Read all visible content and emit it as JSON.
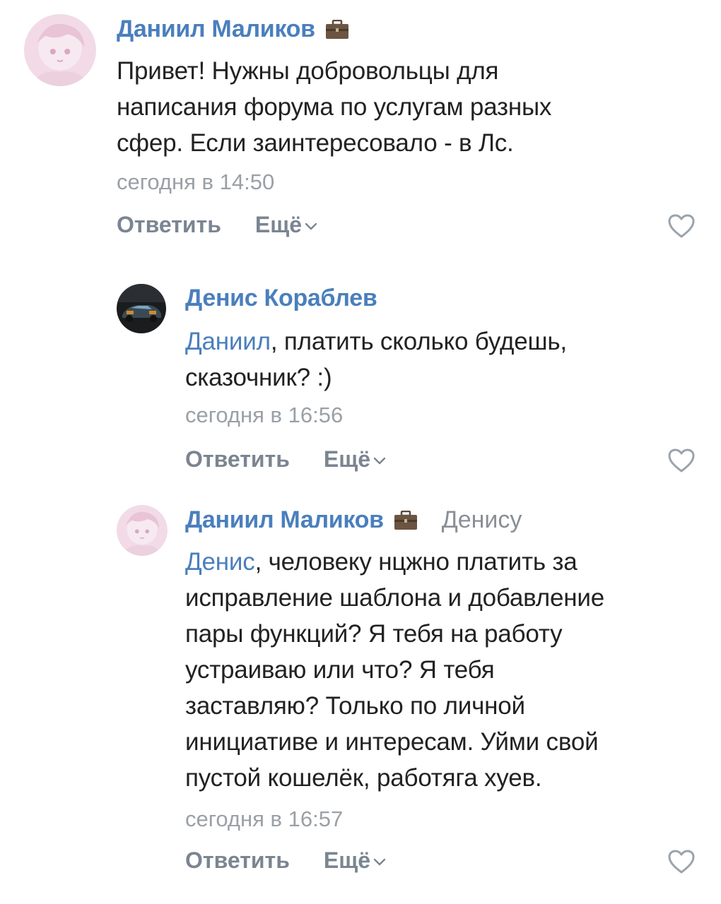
{
  "comments": [
    {
      "author": "Даниил Маликов",
      "badge_icon": "briefcase-icon",
      "text_lines": [
        "Привет! Нужны добровольцы для",
        "написания форума по услугам разных",
        "сфер. Если заинтересовало - в Лс."
      ],
      "time": "сегодня в 14:50",
      "reply_label": "Ответить",
      "more_label": "Ещё"
    },
    {
      "author": "Денис Кораблев",
      "mention": "Даниил",
      "text_after_mention": ", платить сколько будешь,",
      "text_lines": [
        "сказочник? :)"
      ],
      "time": "сегодня в 16:56",
      "reply_label": "Ответить",
      "more_label": "Ещё"
    },
    {
      "author": "Даниил Маликов",
      "badge_icon": "briefcase-icon",
      "reply_to": "Денису",
      "mention": "Денис",
      "text_after_mention": ", человеку нцжно платить за",
      "text_lines": [
        "исправление шаблона и добавление",
        "пары функций? Я тебя на работу",
        "устраиваю или что? Я тебя",
        "заставляю? Только по личной",
        "инициативе и интересам. Уйми свой",
        "пустой кошелёк, работяга хуев."
      ],
      "time": "сегодня в 16:57",
      "reply_label": "Ответить",
      "more_label": "Ещё"
    }
  ],
  "colors": {
    "link": "#4a7fbd",
    "text": "#222222",
    "meta": "#9aa0a6",
    "action": "#7b8591"
  }
}
